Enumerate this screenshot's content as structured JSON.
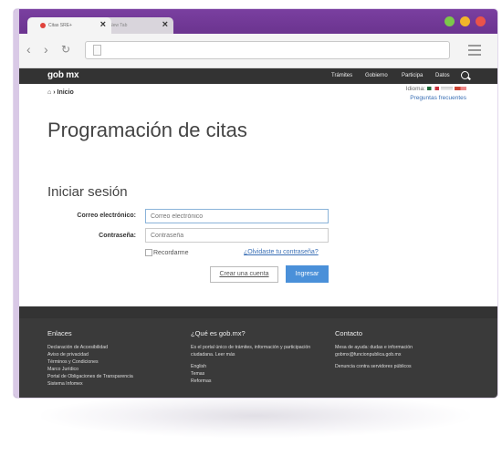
{
  "browser": {
    "tabs": [
      {
        "label": "Citas SRE+",
        "close": "×",
        "active": true
      },
      {
        "label": "New Tab",
        "close": "×",
        "active": false
      }
    ],
    "window_controls": [
      "green-button",
      "yellow-button",
      "red-button"
    ],
    "url": ""
  },
  "site": {
    "logo": "gob mx",
    "nav": [
      "Trámites",
      "Gobierno",
      "Participa",
      "Datos"
    ]
  },
  "page": {
    "breadcrumb": "› Inicio",
    "language_label": "Idioma:",
    "faq_link": "Preguntas frecuentes",
    "title": "Programación de citas"
  },
  "login": {
    "heading": "Iniciar sesión",
    "email_label": "Correo electrónico:",
    "email_placeholder": "Correo electrónico",
    "password_label": "Contraseña:",
    "password_placeholder": "Contraseña",
    "remember_label": "Recordarme",
    "forgot_link": "¿Olvidaste tu contraseña?",
    "create_account": "Crear una cuenta",
    "submit": "Ingresar"
  },
  "footer": {
    "links_title": "Enlaces",
    "links": [
      "Declaración de Accesibilidad",
      "Aviso de privacidad",
      "Términos y Condiciones",
      "Marco Jurídico",
      "Portal de Obligaciones de Transparencia",
      "Sistema Infomex"
    ],
    "about_title": "¿Qué es gob.mx?",
    "about_text_1": "Es el portal único de trámites, información y participación",
    "about_text_2": "ciudadana. Leer más",
    "about_links": [
      "English",
      "Temas",
      "Reformas"
    ],
    "contact_title": "Contacto",
    "contact_text_1": "Mesa de ayuda: dudas e información",
    "contact_text_2": "gobmx@funcionpublica.gob.mx",
    "contact_report": "Denuncia contra servidores públicos"
  },
  "colors": {
    "tabbar": "#6b348f",
    "header": "#333333",
    "footer": "#3a3a3a",
    "accent": "#4a90d9",
    "link": "#3a6fb5"
  }
}
